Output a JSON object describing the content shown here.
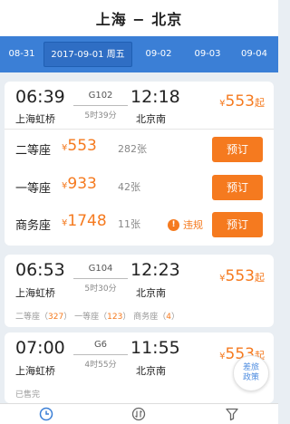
{
  "header": {
    "title": "上海 − 北京"
  },
  "dates": [
    "08-31",
    "2017-09-01 周五",
    "09-02",
    "09-03",
    "09-04"
  ],
  "trains": [
    {
      "dep_time": "06:39",
      "dep_station": "上海虹桥",
      "train_no": "G102",
      "duration": "5时39分",
      "arr_time": "12:18",
      "arr_station": "北京南",
      "price": "553",
      "price_suffix": "起",
      "seats": [
        {
          "name": "二等座",
          "price": "553",
          "count": "282张",
          "button": "预订"
        },
        {
          "name": "一等座",
          "price": "933",
          "count": "42张",
          "button": "预订"
        },
        {
          "name": "商务座",
          "price": "1748",
          "count": "11张",
          "button": "预订",
          "notice": "违规"
        }
      ]
    },
    {
      "dep_time": "06:53",
      "dep_station": "上海虹桥",
      "train_no": "G104",
      "duration": "5时30分",
      "arr_time": "12:23",
      "arr_station": "北京南",
      "price": "553",
      "price_suffix": "起",
      "seat_summary": [
        {
          "name": "二等座",
          "count": "327"
        },
        {
          "name": "一等座",
          "count": "123"
        },
        {
          "name": "商务座",
          "count": "4"
        }
      ]
    },
    {
      "dep_time": "07:00",
      "dep_station": "上海虹桥",
      "train_no": "G6",
      "duration": "4时55分",
      "arr_time": "11:55",
      "arr_station": "北京南",
      "price": "553",
      "price_suffix": "起",
      "status": "已售完"
    }
  ],
  "currency": "¥",
  "policy_button": {
    "line1": "差旅",
    "line2": "政策"
  },
  "bottom_tabs": [
    "clock-icon",
    "sort-icon",
    "filter-icon"
  ],
  "colors": {
    "accent": "#f57a1f",
    "date_bar": "#3b7fd6",
    "policy": "#4f8de0"
  }
}
